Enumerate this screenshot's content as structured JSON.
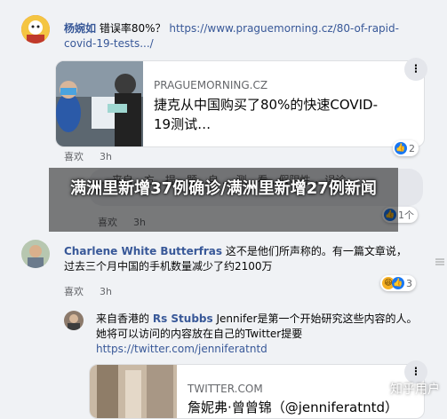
{
  "comment1": {
    "author": "杨婉如",
    "text": "错误率80%？",
    "link_text": "https://www.praguemorning.cz/80-of-rapid-covid-19-tests.../",
    "preview": {
      "source": "PRAGUEMORNING.CZ",
      "title": "捷克从中国购买了80%的快速COVID-19测试…"
    },
    "like_label": "喜欢",
    "time": "3h",
    "reaction_count": "2"
  },
  "comment2": {
    "partial_text": "… 来自…方…提…题…自 … 测…看…假阴性 ，误诊",
    "like_label": "喜欢",
    "time": "3h",
    "reaction_count": "1个"
  },
  "comment3": {
    "author": "Charlene White Butterfras",
    "text": "这不是他们所声称的。有一篇文章说，过去三个月中国的手机数量减少了约2100万",
    "like_label": "喜欢",
    "time": "3h",
    "reaction_count": "3"
  },
  "reply1": {
    "prefix": "来自香港的",
    "author": "Rs Stubbs",
    "text": "Jennifer是第一个开始研究这些内容的人。她将可以访问的内容放在自己的Twitter提要",
    "link_text": "https://twitter.com/jenniferatntd",
    "preview": {
      "source": "TWITTER.COM",
      "title": "詹妮弗·曾曾锦（@jenniferatntd）"
    }
  },
  "overlay": {
    "headline": "满洲里新增37例确诊/满洲里新增27例新闻"
  },
  "watermark": "知乎用户",
  "icons": {
    "more": "more-options-icon",
    "like": "like-icon",
    "haha": "haha-icon"
  },
  "colors": {
    "link": "#385898",
    "like_blue": "#1877f2",
    "bubble": "#f0f2f5"
  }
}
